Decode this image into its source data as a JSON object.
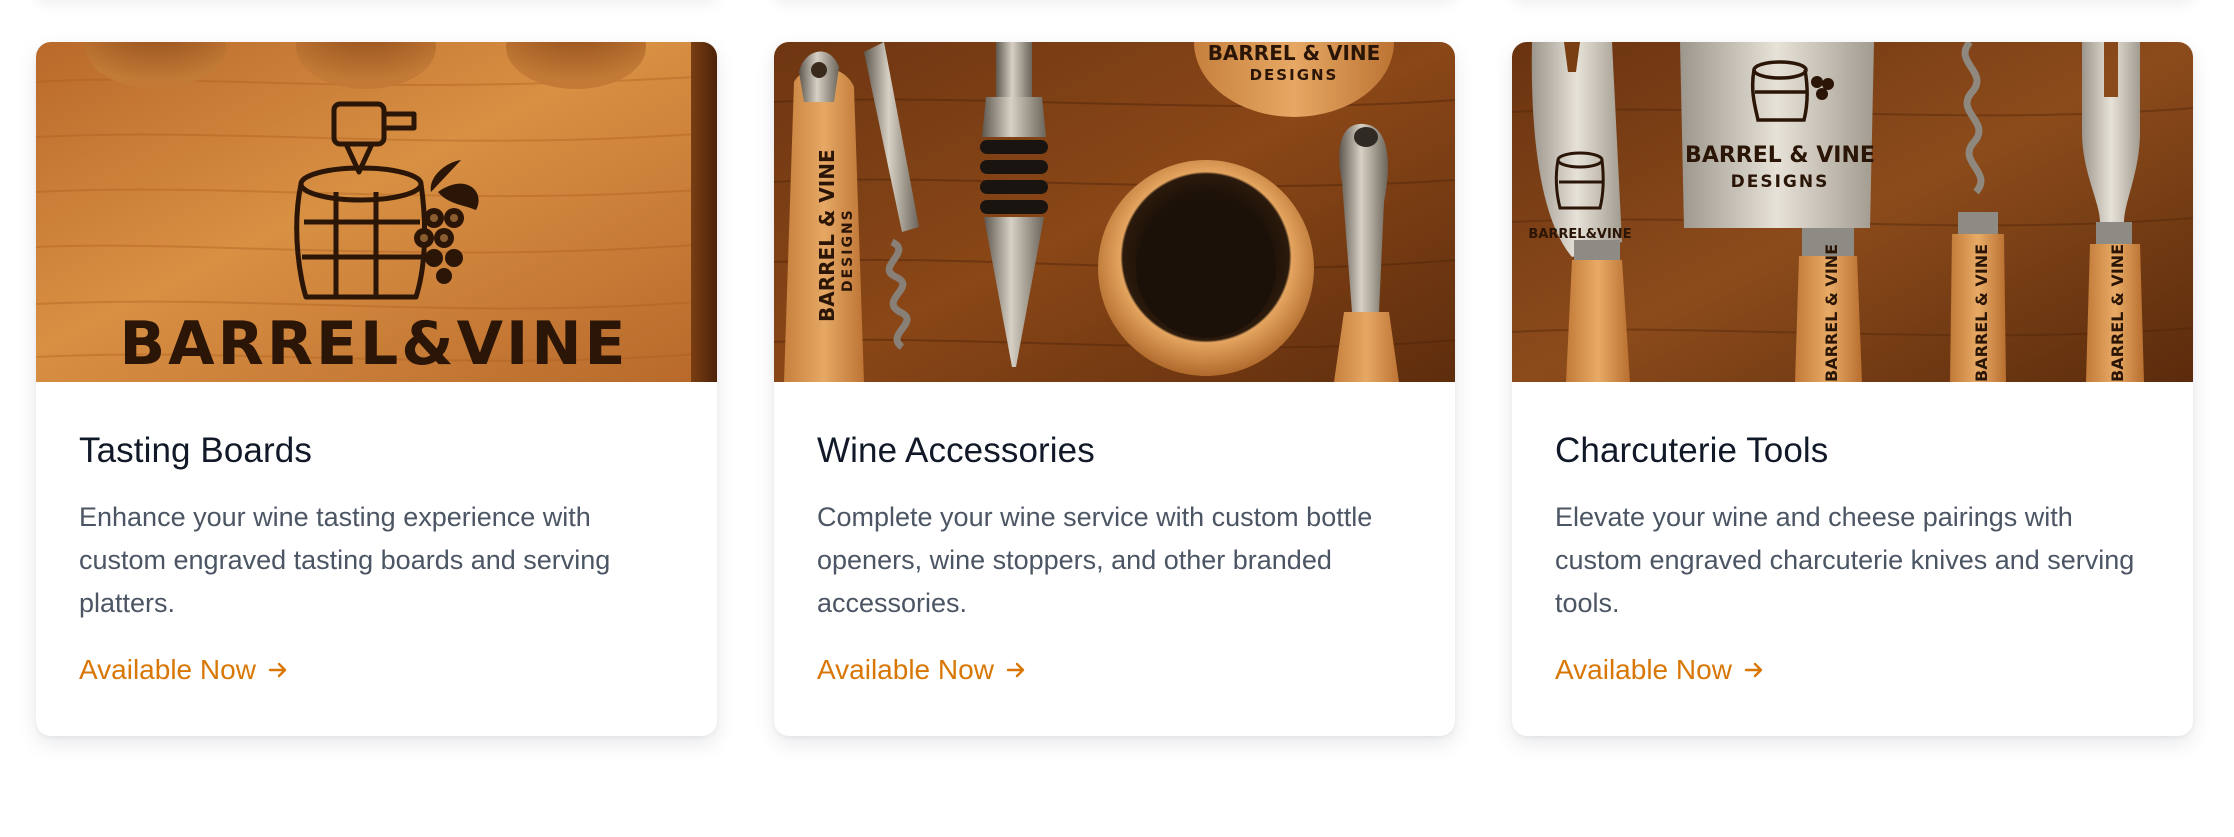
{
  "colors": {
    "accent": "#d97706",
    "title": "#111827",
    "body": "#4b5563",
    "wood_light": "#d18a3e",
    "wood_dark": "#7a3e13",
    "engrave": "#2a1506"
  },
  "cards": [
    {
      "title": "Tasting Boards",
      "description": "Enhance your wine tasting experience with custom engraved tasting boards and serving platters.",
      "link": "Available Now",
      "image": {
        "subject": "engraved wooden tasting board",
        "brand_text": "BARREL&VINE"
      }
    },
    {
      "title": "Wine Accessories",
      "description": "Complete your wine service with custom bottle openers, wine stoppers, and other branded accessories.",
      "link": "Available Now",
      "image": {
        "subject": "engraved corkscrew, bottle stopper, drip ring and pourer",
        "brand_text": "BARREL & VINE",
        "brand_sub": "DESIGNS"
      }
    },
    {
      "title": "Charcuterie Tools",
      "description": "Elevate your wine and cheese pairings with custom engraved charcuterie knives and serving tools.",
      "link": "Available Now",
      "image": {
        "subject": "engraved cheese knives, cleaver, corkscrew and fork",
        "brand_text": "BARREL & VINE",
        "brand_sub": "DESIGNS",
        "brand_text_small": "BARREL&VINE"
      }
    }
  ]
}
